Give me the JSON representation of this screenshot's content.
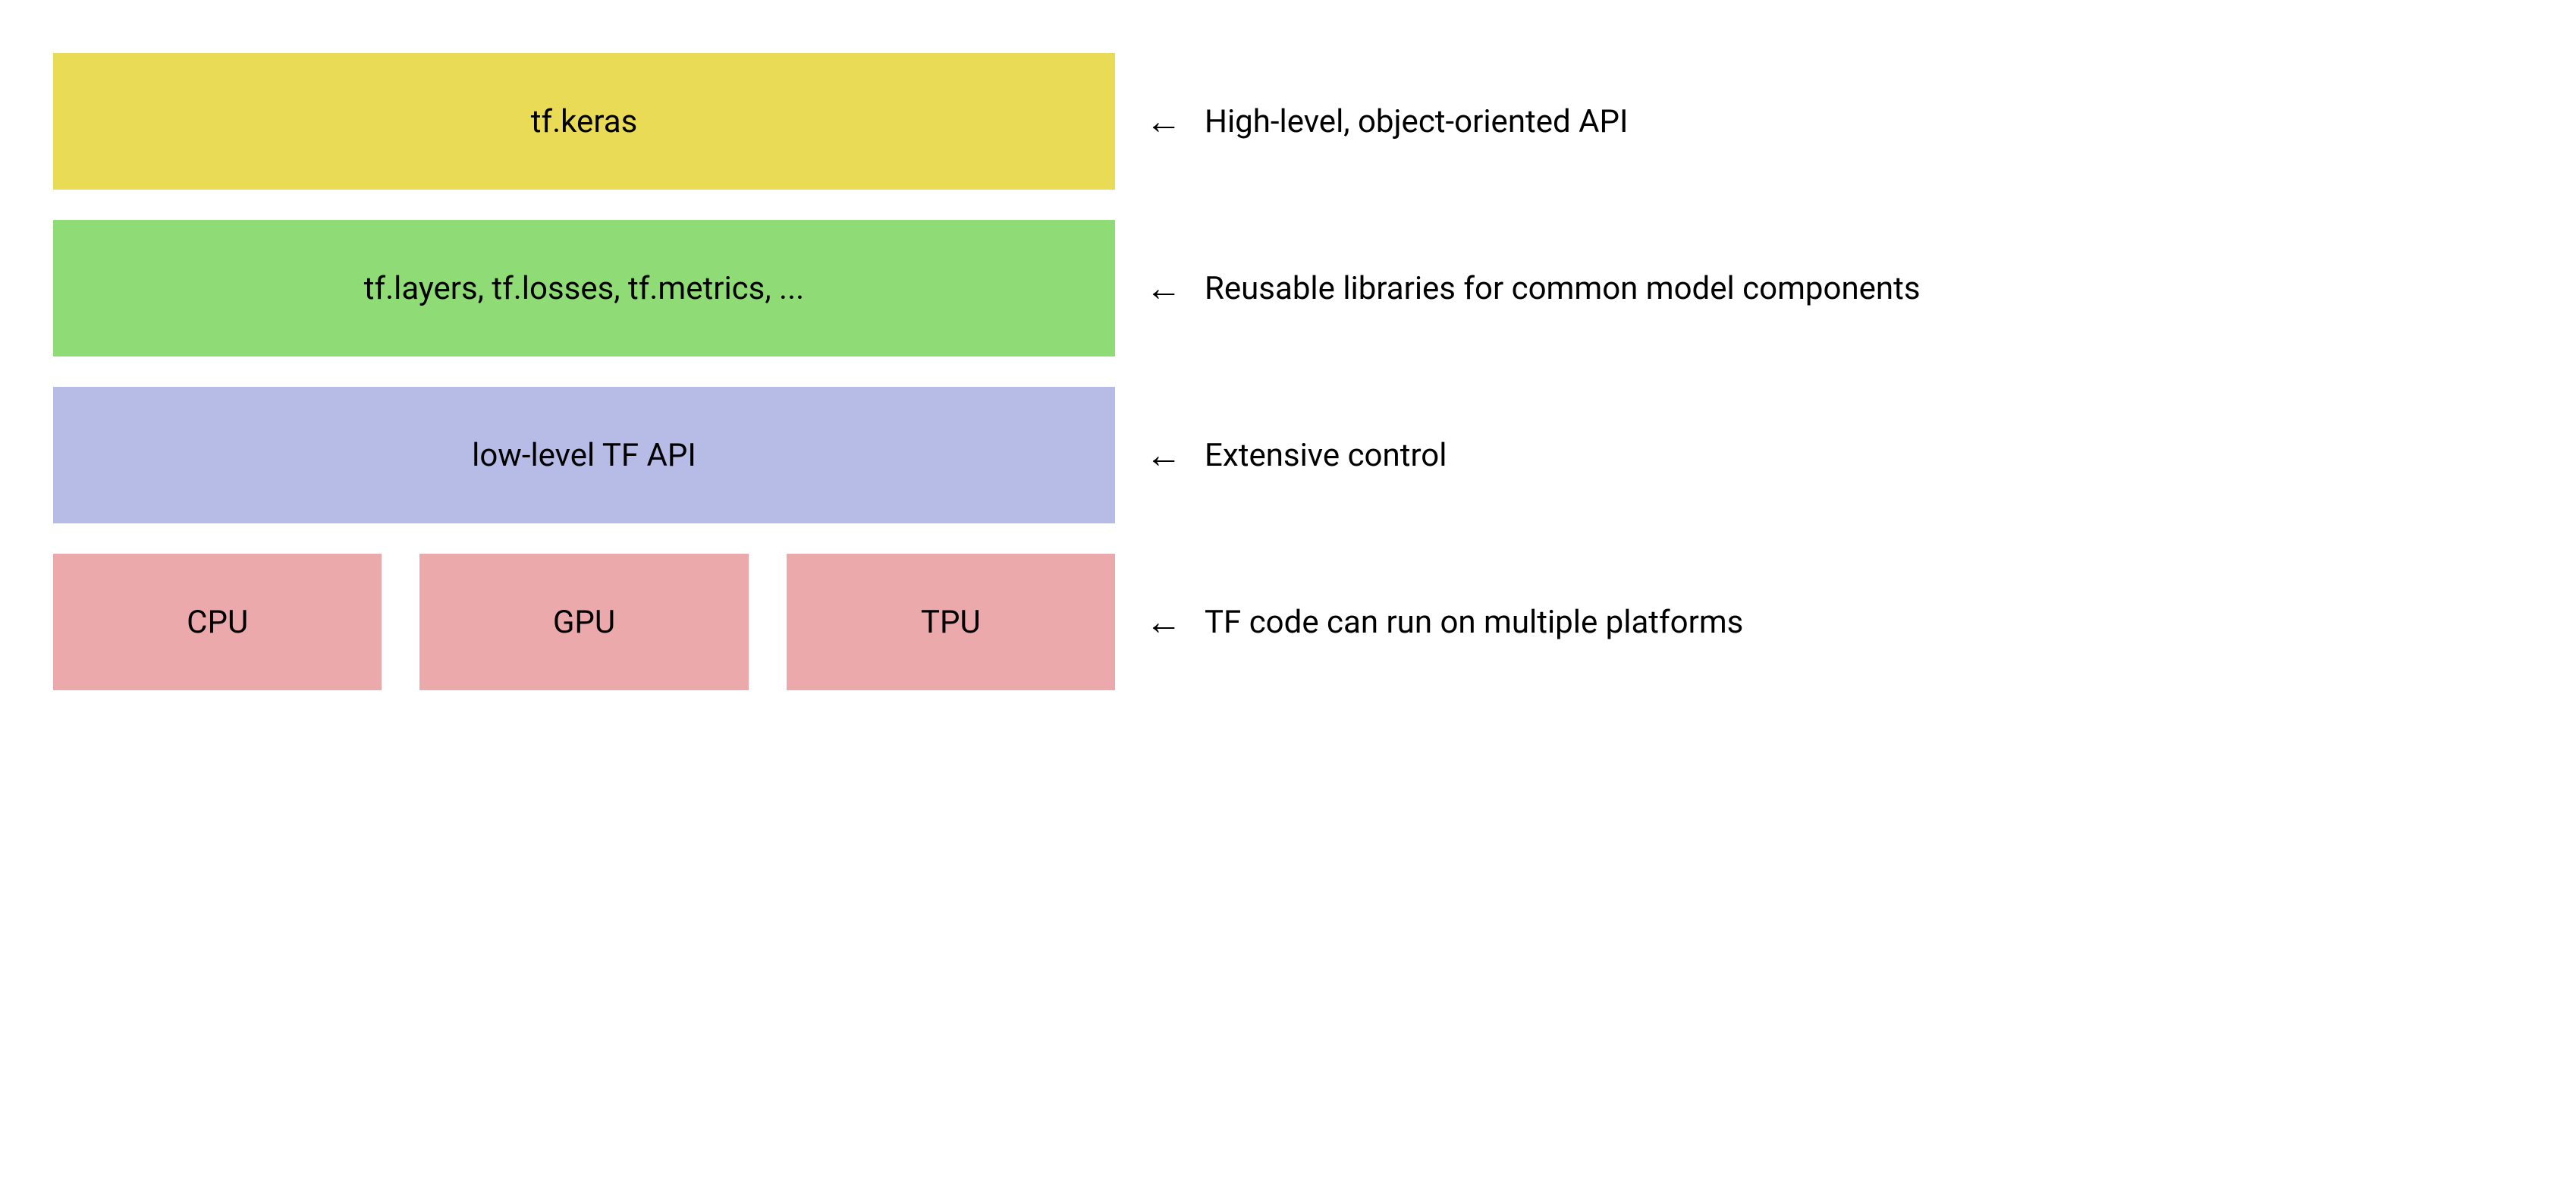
{
  "layers": [
    {
      "label": "tf.keras",
      "color": "yellow",
      "description": "High-level, object-oriented API"
    },
    {
      "label": "tf.layers, tf.losses, tf.metrics, ...",
      "color": "green",
      "description": "Reusable libraries for common model components"
    },
    {
      "label": "low-level TF API",
      "color": "purple",
      "description": "Extensive control"
    }
  ],
  "hardware": {
    "items": [
      "CPU",
      "GPU",
      "TPU"
    ],
    "description": "TF code can run on multiple platforms"
  },
  "arrow_glyph": "←"
}
